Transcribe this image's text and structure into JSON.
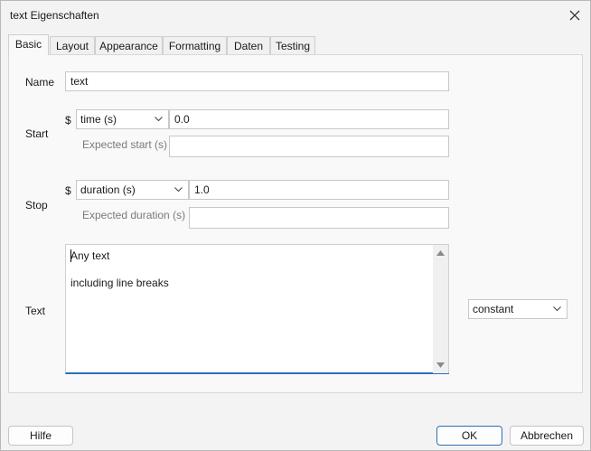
{
  "window": {
    "title": "text Eigenschaften",
    "close_icon": "close-icon"
  },
  "tabs": [
    {
      "label": "Basic",
      "active": true
    },
    {
      "label": "Layout"
    },
    {
      "label": "Appearance"
    },
    {
      "label": "Formatting"
    },
    {
      "label": "Daten"
    },
    {
      "label": "Testing"
    }
  ],
  "form": {
    "name": {
      "label": "Name",
      "value": "text"
    },
    "start": {
      "label": "Start",
      "dollar": "$",
      "type_selected": "time (s)",
      "value": "0.0",
      "expected_label": "Expected start (s)",
      "expected_value": ""
    },
    "stop": {
      "label": "Stop",
      "dollar": "$",
      "type_selected": "duration (s)",
      "value": "1.0",
      "expected_label": "Expected duration (s)",
      "expected_value": ""
    },
    "text": {
      "label": "Text",
      "lines": [
        "Any text",
        "",
        "including line breaks"
      ],
      "update_selected": "constant"
    }
  },
  "footer": {
    "help_label": "Hilfe",
    "ok_label": "OK",
    "cancel_label": "Abbrechen"
  }
}
